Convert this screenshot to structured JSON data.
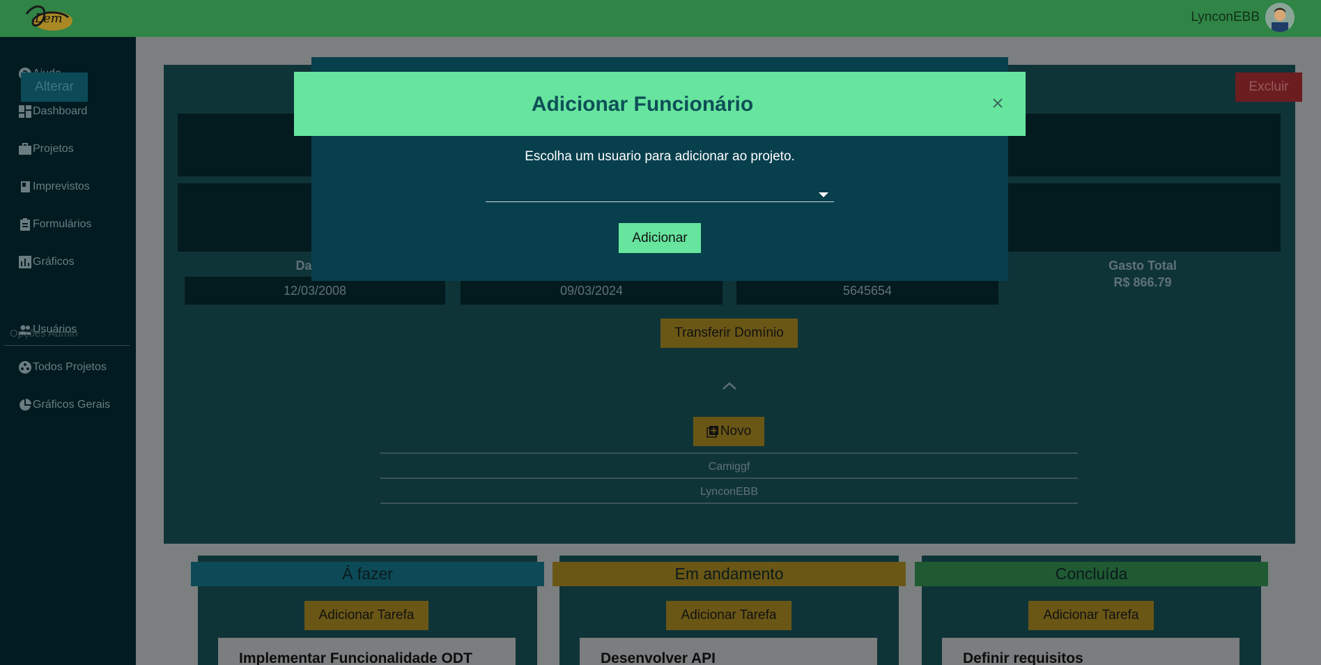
{
  "topbar": {
    "username": "LynconEBB",
    "logo_text": "Lem"
  },
  "sidebar": {
    "items": [
      {
        "label": "Ajuda",
        "icon": "help-circle-icon"
      },
      {
        "label": "Dashboard",
        "icon": "dashboard-icon"
      },
      {
        "label": "Projetos",
        "icon": "briefcase-icon"
      },
      {
        "label": "Imprevistos",
        "icon": "book-icon"
      },
      {
        "label": "Formulários",
        "icon": "clipboard-icon"
      },
      {
        "label": "Gráficos",
        "icon": "bar-chart-icon"
      }
    ],
    "admin_label": "Opções Admin",
    "admin_items": [
      {
        "label": "Usuários",
        "icon": "users-icon"
      },
      {
        "label": "Todos Projetos",
        "icon": "projects-icon"
      },
      {
        "label": "Gráficos Gerais",
        "icon": "pie-chart-icon"
      }
    ]
  },
  "project": {
    "alterar_label": "Alterar",
    "excluir_label": "Excluir",
    "start_label": "Data d",
    "start_value": "12/03/2008",
    "end_value": "09/03/2024",
    "budget_value": "5645654",
    "total_label": "Gasto Total",
    "total_value": "R$ 866.79",
    "transfer_label": "Transferir Domínio"
  },
  "members": {
    "new_label": "Novo",
    "list": [
      "Camiggf",
      "LynconEBB"
    ]
  },
  "kanban": {
    "columns": [
      {
        "title": "Á fazer",
        "add_label": "Adicionar Tarefa",
        "first_task": "Implementar Funcionalidade ODT",
        "color": "#0c4a57"
      },
      {
        "title": "Em andamento",
        "add_label": "Adicionar Tarefa",
        "first_task": "Desenvolver API",
        "color": "#6a5716"
      },
      {
        "title": "Concluída",
        "add_label": "Adicionar Tarefa",
        "first_task": "Definir requisitos",
        "color": "#1f5a33"
      }
    ]
  },
  "modal": {
    "title": "Adicionar Funcionário",
    "text": "Escolha um usuario para adicionar ao projeto.",
    "select_value": "",
    "add_label": "Adicionar"
  },
  "colors": {
    "topbar": "#2f8446",
    "sidebar": "#011b21",
    "modal_header": "#67e59e",
    "modal_body": "#073f4d"
  }
}
